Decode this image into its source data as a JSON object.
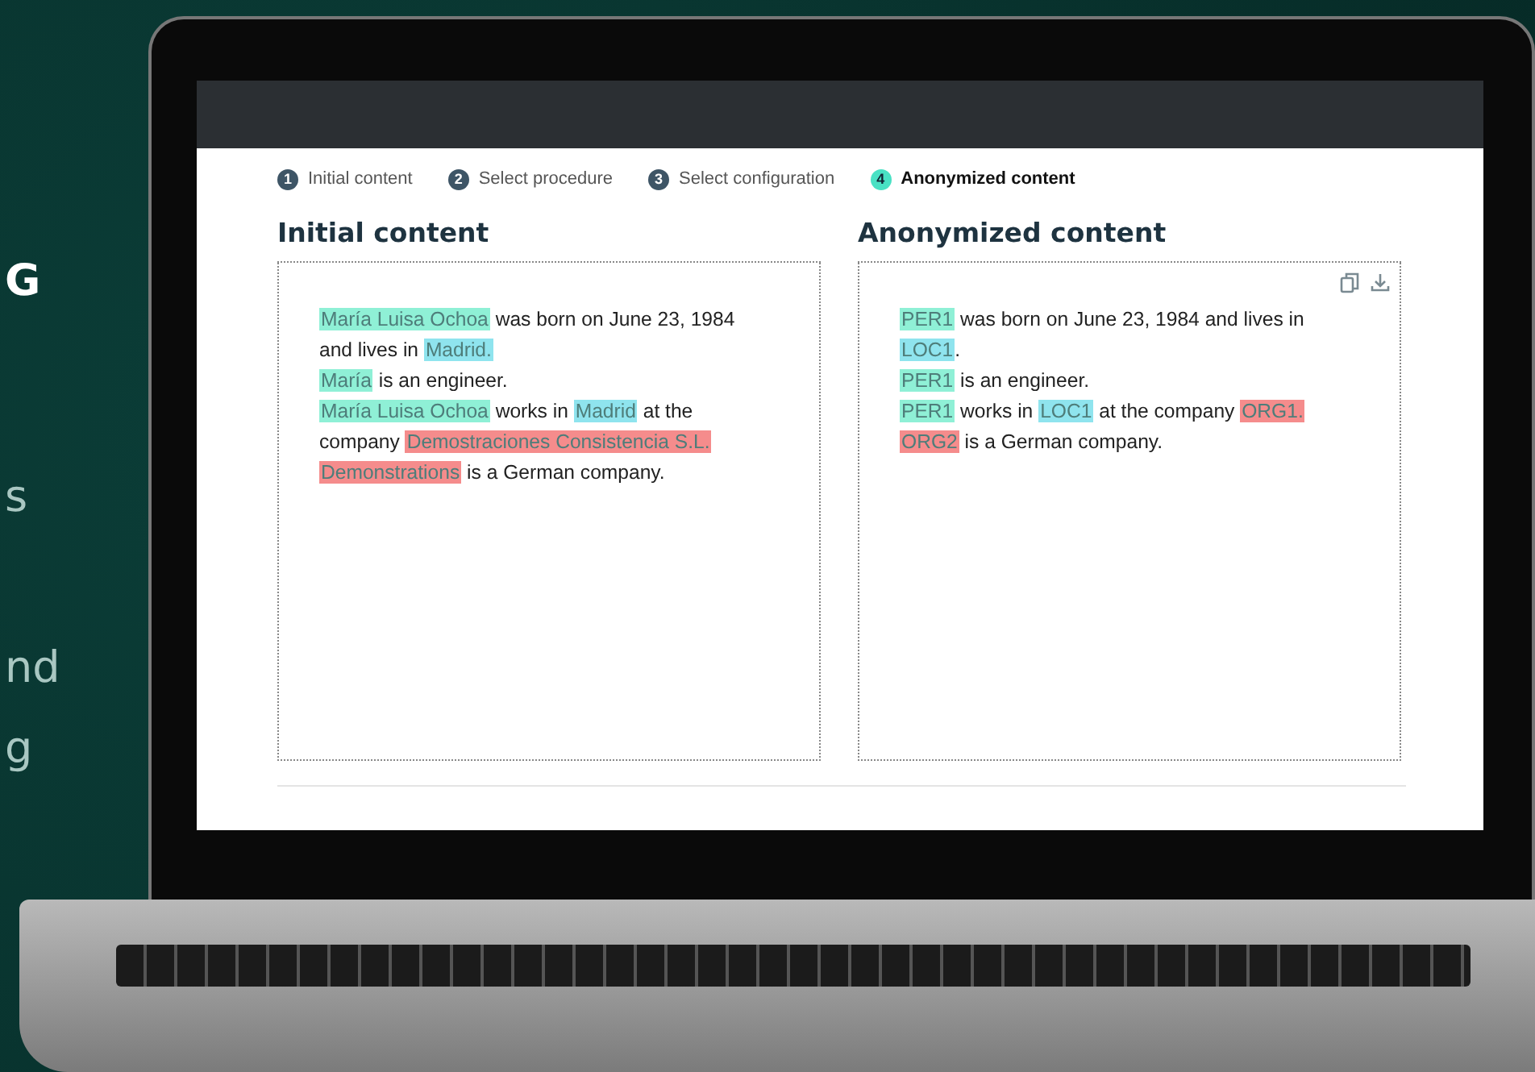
{
  "side_text": [
    {
      "text": "G",
      "bold": true
    },
    {
      "text": "s",
      "bold": false
    },
    {
      "text": "nd",
      "bold": false
    },
    {
      "text": "g",
      "bold": false
    }
  ],
  "steps": [
    {
      "number": "1",
      "label": "Initial content",
      "selected": false
    },
    {
      "number": "2",
      "label": "Select procedure",
      "selected": false
    },
    {
      "number": "3",
      "label": "Select configuration",
      "selected": false
    },
    {
      "number": "4",
      "label": "Anonymized content",
      "selected": true
    }
  ],
  "panels": [
    {
      "title": "Initial content",
      "actions": false,
      "lines": [
        [
          {
            "text": "María Luisa Ochoa",
            "color": "#8ff0d6"
          },
          {
            "text": " was born on June 23, 1984"
          }
        ],
        [
          {
            "text": "and lives in "
          },
          {
            "text": "Madrid.",
            "color": "#8fe4ee"
          }
        ],
        [
          {
            "text": "María",
            "color": "#8ff0d6"
          },
          {
            "text": " is an engineer."
          }
        ],
        [
          {
            "text": "María Luisa Ochoa",
            "color": "#8ff0d6"
          },
          {
            "text": " works in "
          },
          {
            "text": "Madrid",
            "color": "#8fe4ee"
          },
          {
            "text": " at the"
          }
        ],
        [
          {
            "text": "company "
          },
          {
            "text": "Demostraciones Consistencia S.L.",
            "color": "#f58c8c"
          }
        ],
        [
          {
            "text": "Demonstrations",
            "color": "#f58c8c"
          },
          {
            "text": " is a German company."
          }
        ]
      ]
    },
    {
      "title": "Anonymized content",
      "actions": true,
      "lines": [
        [
          {
            "text": "PER1",
            "color": "#8ff0d6"
          },
          {
            "text": " was born on June 23, 1984 and lives in"
          }
        ],
        [
          {
            "text": "LOC1",
            "color": "#8fe4ee"
          },
          {
            "text": "."
          }
        ],
        [
          {
            "text": "PER1",
            "color": "#8ff0d6"
          },
          {
            "text": " is an engineer."
          }
        ],
        [
          {
            "text": "PER1",
            "color": "#8ff0d6"
          },
          {
            "text": " works in "
          },
          {
            "text": "LOC1",
            "color": "#8fe4ee"
          },
          {
            "text": " at the company "
          },
          {
            "text": "ORG1.",
            "color": "#f58c8c"
          }
        ],
        [
          {
            "text": "ORG2",
            "color": "#f58c8c"
          },
          {
            "text": " is a German company."
          }
        ]
      ]
    }
  ]
}
